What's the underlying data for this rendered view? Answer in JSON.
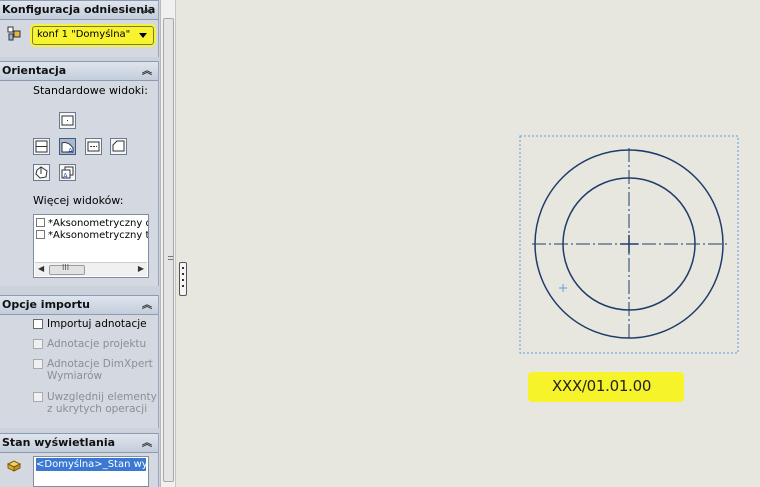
{
  "config": {
    "title": "Konfiguracja odniesienia",
    "selected": "konf 1 \"Domyślna\"",
    "icon": "config-icon"
  },
  "orientation": {
    "title": "Orientacja",
    "standard_views_label": "Standardowe widoki:",
    "more_views_label": "Więcej widoków:",
    "more_views": [
      "*Aksonometryczny d",
      "*Aksonometryczny tr"
    ],
    "scroll_mark": "III"
  },
  "import": {
    "title": "Opcje importu",
    "options": [
      {
        "label": "Importuj adnotacje",
        "enabled": true
      },
      {
        "label": "Adnotacje projektu",
        "enabled": false
      },
      {
        "label_line1": "Adnotacje DimXpert",
        "label_line2": "Wymiarów",
        "enabled": false
      },
      {
        "label_line1": "Uwzględnij elementy",
        "label_line2": "z ukrytych operacji",
        "enabled": false
      }
    ]
  },
  "display": {
    "title": "Stan wyświetlania",
    "item": "<Domyślna>_Stan wyś",
    "icon": "display-state-icon"
  },
  "drawing": {
    "view_label": "XXX/01.01.00",
    "highlight_color": "#f6f32a",
    "line_color": "#1f3c6b",
    "frame_color": "#5aa0d8"
  }
}
